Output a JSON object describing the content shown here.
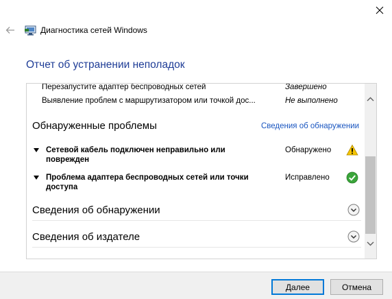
{
  "window": {
    "title": "Диагностика сетей Windows"
  },
  "report": {
    "title": "Отчет об устранении неполадок"
  },
  "steps": [
    {
      "name": "Перезапустите адаптер беспроводных сетей",
      "status": "Завершено"
    },
    {
      "name": "Выявление проблем с маршрутизатором или точкой дос...",
      "status": "Не выполнено"
    }
  ],
  "problems_section": {
    "title": "Обнаруженные проблемы",
    "link": "Сведения об обнаружении"
  },
  "problems": [
    {
      "name": "Сетевой кабель подключен неправильно или поврежден",
      "status": "Обнаружено",
      "icon": "warning-icon"
    },
    {
      "name": "Проблема адаптера беспроводных сетей или точки доступа",
      "status": "Исправлено",
      "icon": "check-icon"
    }
  ],
  "expanders": [
    {
      "label": "Сведения об обнаружении"
    },
    {
      "label": "Сведения об издателе"
    }
  ],
  "buttons": {
    "next": "Далее",
    "cancel": "Отмена"
  },
  "colors": {
    "title_blue": "#1e3c96",
    "link_blue": "#1a56c0",
    "warning_yellow": "#f5c400",
    "success_green": "#3aa53a",
    "accent": "#0078d7"
  }
}
